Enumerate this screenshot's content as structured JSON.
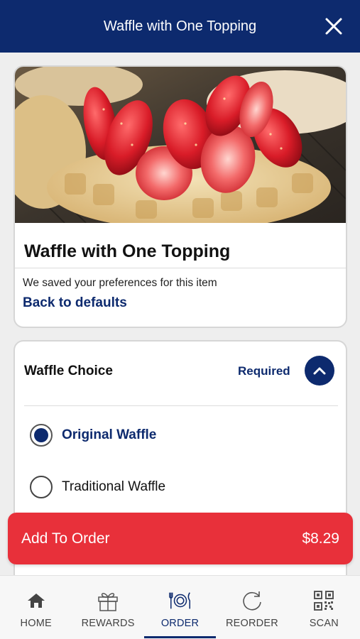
{
  "header": {
    "title": "Waffle with One Topping",
    "close_icon": "close-icon"
  },
  "item": {
    "name": "Waffle with One Topping",
    "image": "waffle-with-strawberries-photo",
    "preferences_text": "We saved your preferences for this item",
    "defaults_link": "Back to defaults"
  },
  "choice": {
    "title": "Waffle Choice",
    "required_label": "Required",
    "collapse_icon": "chevron-up-icon",
    "options": [
      {
        "label": "Original Waffle",
        "selected": true
      },
      {
        "label": "Traditional Waffle",
        "selected": false
      }
    ]
  },
  "add_to_order": {
    "label": "Add To Order",
    "price": "$8.29"
  },
  "nav": {
    "items": [
      {
        "label": "HOME",
        "icon": "home-icon",
        "active": false
      },
      {
        "label": "REWARDS",
        "icon": "gift-icon",
        "active": false
      },
      {
        "label": "ORDER",
        "icon": "plate-cutlery-icon",
        "active": true
      },
      {
        "label": "REORDER",
        "icon": "reorder-icon",
        "active": false
      },
      {
        "label": "SCAN",
        "icon": "qr-code-icon",
        "active": false
      }
    ]
  },
  "colors": {
    "primary": "#0d2a6e",
    "accent": "#e8303a",
    "background": "#eeeeee"
  }
}
